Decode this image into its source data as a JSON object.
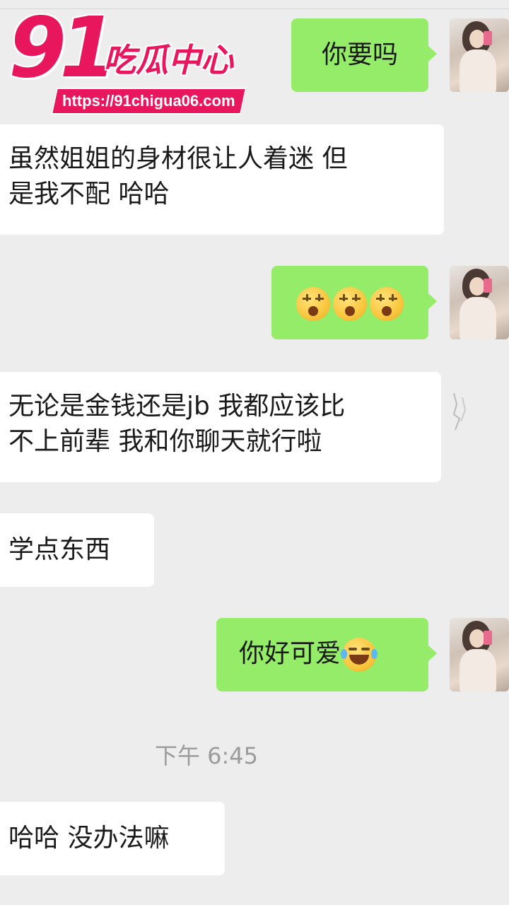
{
  "watermark": {
    "number": "91",
    "name": "吃瓜中心",
    "url": "https://91chigua06.com"
  },
  "messages": [
    {
      "side": "right",
      "text": "你要吗"
    },
    {
      "side": "left",
      "line1": "虽然姐姐的身材很让人着迷 但",
      "line2": "是我不配 哈哈"
    },
    {
      "side": "right",
      "emoji": "sleepy-face-icon x3"
    },
    {
      "side": "left",
      "line1": "无论是金钱还是jb 我都应该比",
      "line2": "不上前辈 我和你聊天就行啦"
    },
    {
      "side": "left",
      "text": "学点东西"
    },
    {
      "side": "right",
      "text": "你好可爱",
      "emoji": "tears-of-joy-icon"
    },
    {
      "side": "left",
      "text": "哈哈 没办法嘛"
    }
  ],
  "timestamp": "下午 6:45",
  "colors": {
    "background": "#ededed",
    "sent_bubble": "#95ec69",
    "received_bubble": "#ffffff",
    "watermark": "#e8175d"
  }
}
